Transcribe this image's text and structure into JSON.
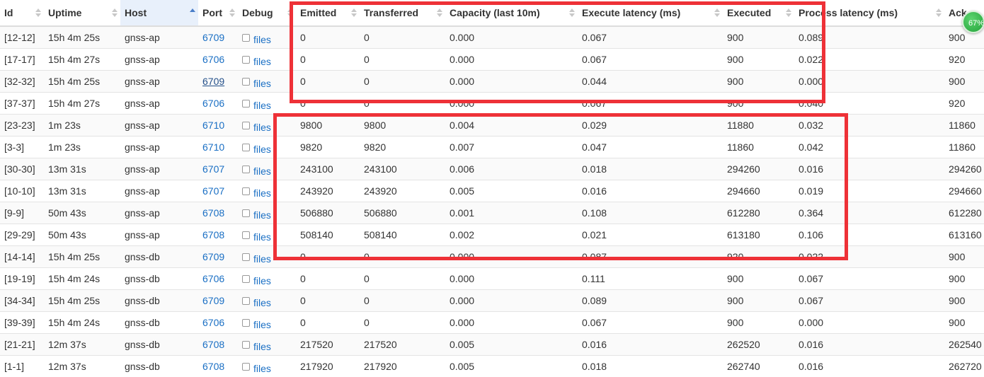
{
  "table": {
    "columns": [
      "Id",
      "Uptime",
      "Host",
      "Port",
      "Debug",
      "Emitted",
      "Transferred",
      "Capacity (last 10m)",
      "Execute latency (ms)",
      "Executed",
      "Process latency (ms)",
      "Ack"
    ],
    "sorted_column": "Host",
    "sort_direction": "ascending",
    "debug_link_label": "files",
    "rows": [
      {
        "id": "[12-12]",
        "uptime": "15h 4m 25s",
        "host": "gnss-ap",
        "port": "6709",
        "emitted": "0",
        "transferred": "0",
        "capacity": "0.000",
        "execute_latency": "0.067",
        "executed": "900",
        "process_latency": "0.089",
        "acked": "900"
      },
      {
        "id": "[17-17]",
        "uptime": "15h 4m 27s",
        "host": "gnss-ap",
        "port": "6706",
        "emitted": "0",
        "transferred": "0",
        "capacity": "0.000",
        "execute_latency": "0.067",
        "executed": "900",
        "process_latency": "0.022",
        "acked": "920"
      },
      {
        "id": "[32-32]",
        "uptime": "15h 4m 25s",
        "host": "gnss-ap",
        "port": "6709",
        "emitted": "0",
        "transferred": "0",
        "capacity": "0.000",
        "execute_latency": "0.044",
        "executed": "900",
        "process_latency": "0.000",
        "acked": "900"
      },
      {
        "id": "[37-37]",
        "uptime": "15h 4m 27s",
        "host": "gnss-ap",
        "port": "6706",
        "emitted": "0",
        "transferred": "0",
        "capacity": "0.000",
        "execute_latency": "0.067",
        "executed": "900",
        "process_latency": "0.040",
        "acked": "920"
      },
      {
        "id": "[23-23]",
        "uptime": "1m 23s",
        "host": "gnss-ap",
        "port": "6710",
        "emitted": "9800",
        "transferred": "9800",
        "capacity": "0.004",
        "execute_latency": "0.029",
        "executed": "11880",
        "process_latency": "0.032",
        "acked": "11860"
      },
      {
        "id": "[3-3]",
        "uptime": "1m 23s",
        "host": "gnss-ap",
        "port": "6710",
        "emitted": "9820",
        "transferred": "9820",
        "capacity": "0.007",
        "execute_latency": "0.047",
        "executed": "11860",
        "process_latency": "0.042",
        "acked": "11860"
      },
      {
        "id": "[30-30]",
        "uptime": "13m 31s",
        "host": "gnss-ap",
        "port": "6707",
        "emitted": "243100",
        "transferred": "243100",
        "capacity": "0.006",
        "execute_latency": "0.018",
        "executed": "294260",
        "process_latency": "0.016",
        "acked": "294260"
      },
      {
        "id": "[10-10]",
        "uptime": "13m 31s",
        "host": "gnss-ap",
        "port": "6707",
        "emitted": "243920",
        "transferred": "243920",
        "capacity": "0.005",
        "execute_latency": "0.016",
        "executed": "294660",
        "process_latency": "0.019",
        "acked": "294660"
      },
      {
        "id": "[9-9]",
        "uptime": "50m 43s",
        "host": "gnss-ap",
        "port": "6708",
        "emitted": "506880",
        "transferred": "506880",
        "capacity": "0.001",
        "execute_latency": "0.108",
        "executed": "612280",
        "process_latency": "0.364",
        "acked": "612280"
      },
      {
        "id": "[29-29]",
        "uptime": "50m 43s",
        "host": "gnss-ap",
        "port": "6708",
        "emitted": "508140",
        "transferred": "508140",
        "capacity": "0.002",
        "execute_latency": "0.021",
        "executed": "613180",
        "process_latency": "0.106",
        "acked": "613160"
      },
      {
        "id": "[14-14]",
        "uptime": "15h 4m 25s",
        "host": "gnss-db",
        "port": "6709",
        "emitted": "0",
        "transferred": "0",
        "capacity": "0.000",
        "execute_latency": "0.087",
        "executed": "920",
        "process_latency": "0.022",
        "acked": "900"
      },
      {
        "id": "[19-19]",
        "uptime": "15h 4m 24s",
        "host": "gnss-db",
        "port": "6706",
        "emitted": "0",
        "transferred": "0",
        "capacity": "0.000",
        "execute_latency": "0.111",
        "executed": "900",
        "process_latency": "0.067",
        "acked": "900"
      },
      {
        "id": "[34-34]",
        "uptime": "15h 4m 25s",
        "host": "gnss-db",
        "port": "6709",
        "emitted": "0",
        "transferred": "0",
        "capacity": "0.000",
        "execute_latency": "0.089",
        "executed": "900",
        "process_latency": "0.067",
        "acked": "900"
      },
      {
        "id": "[39-39]",
        "uptime": "15h 4m 24s",
        "host": "gnss-db",
        "port": "6706",
        "emitted": "0",
        "transferred": "0",
        "capacity": "0.000",
        "execute_latency": "0.067",
        "executed": "900",
        "process_latency": "0.000",
        "acked": "900"
      },
      {
        "id": "[21-21]",
        "uptime": "12m 37s",
        "host": "gnss-db",
        "port": "6708",
        "emitted": "217520",
        "transferred": "217520",
        "capacity": "0.005",
        "execute_latency": "0.016",
        "executed": "262520",
        "process_latency": "0.016",
        "acked": "262540"
      },
      {
        "id": "[1-1]",
        "uptime": "12m 37s",
        "host": "gnss-db",
        "port": "6708",
        "emitted": "217920",
        "transferred": "217920",
        "capacity": "0.005",
        "execute_latency": "0.018",
        "executed": "262740",
        "process_latency": "0.016",
        "acked": "262720"
      }
    ]
  },
  "highlight_color": "#ee3137",
  "progress_badge": {
    "label": "67%",
    "value": 0.67
  }
}
